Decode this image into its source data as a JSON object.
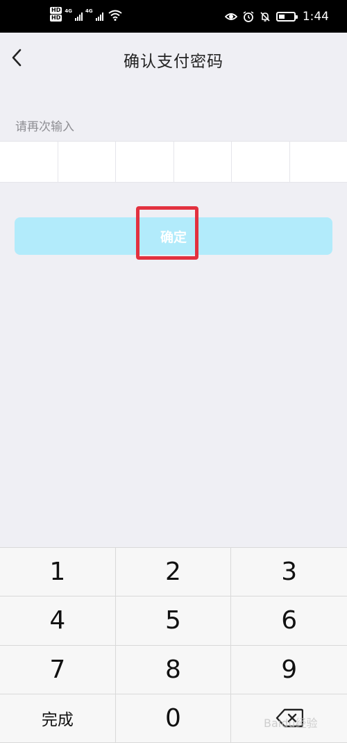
{
  "status_bar": {
    "sim1_badge": "HD",
    "sim2_badge": "HD",
    "net1": "4G",
    "net2": "4G",
    "time": "1:44",
    "icons": [
      "eye-icon",
      "alarm-icon",
      "bell-muted-icon",
      "battery-icon",
      "wifi-icon"
    ],
    "battery_level_percent": 40
  },
  "nav": {
    "title": "确认支付密码",
    "back_icon": "chevron-left-icon"
  },
  "form": {
    "prompt": "请再次输入",
    "pin_length": 6,
    "confirm_label": "确定"
  },
  "keypad": {
    "keys": [
      "1",
      "2",
      "3",
      "4",
      "5",
      "6",
      "7",
      "8",
      "9",
      "完成",
      "0",
      "⌫"
    ]
  },
  "watermark": "Baidu经验",
  "colors": {
    "background": "#efeff4",
    "button": "#b2ebfb",
    "highlight": "#e2313f"
  }
}
